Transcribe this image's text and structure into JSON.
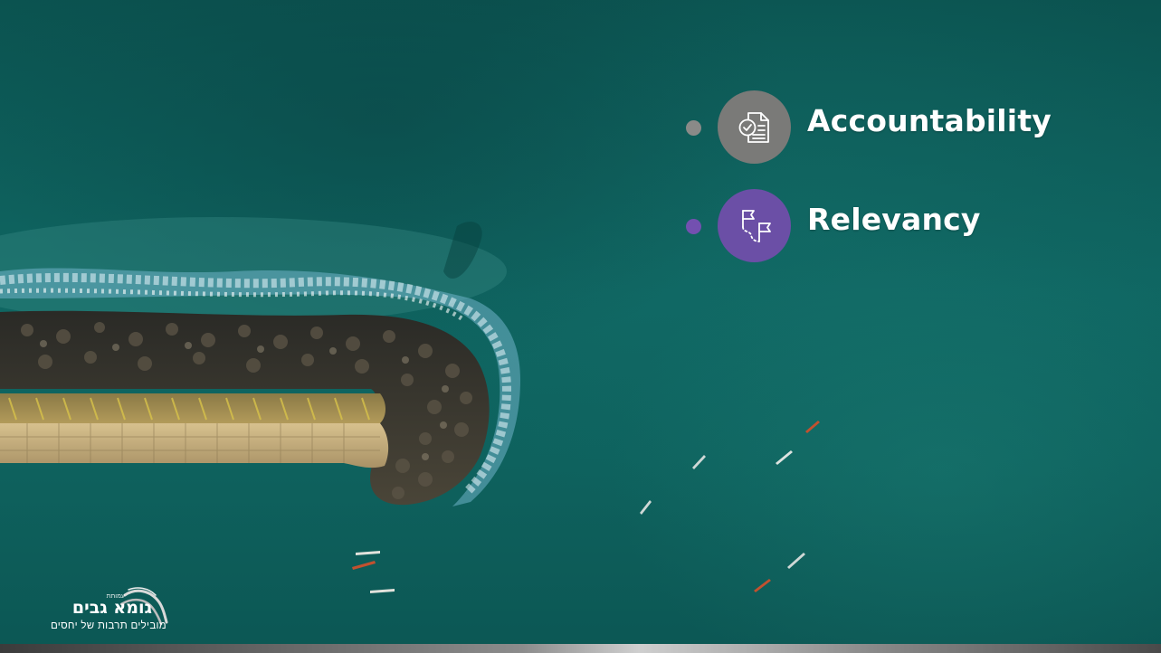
{
  "slide": {
    "items": [
      {
        "label": "Accountability",
        "icon": "document-check-icon",
        "badge_color": "#7a7a78",
        "bullet_color": "#8a8a88"
      },
      {
        "label": "Relevancy",
        "icon": "route-flags-icon",
        "badge_color": "#6b4fa6",
        "bullet_color": "#7350b0"
      }
    ]
  },
  "logo": {
    "name": "גומא גבים",
    "small": "עמותת",
    "tagline": "מובילים תרבות של יחסים"
  }
}
